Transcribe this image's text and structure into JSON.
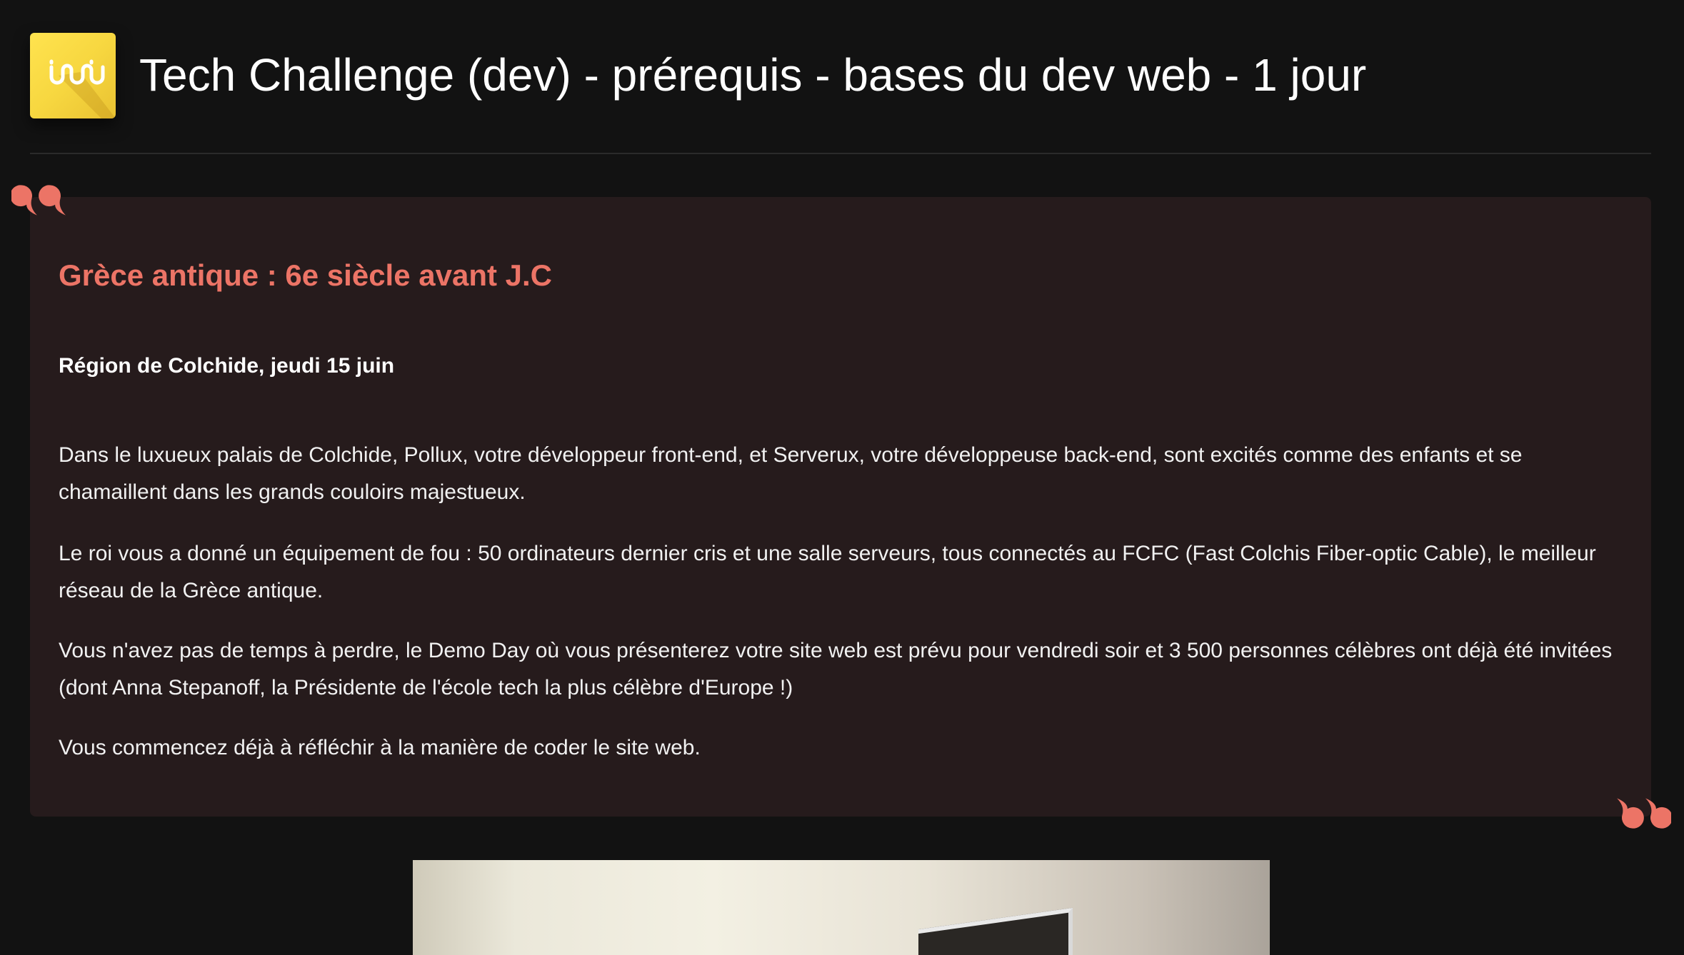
{
  "header": {
    "logo_icon": "wave-logo-icon",
    "title": "Tech Challenge (dev) - prérequis - bases du dev web - 1 jour"
  },
  "story": {
    "title": "Grèce antique : 6e siècle avant J.C",
    "subtitle": "Région de Colchide, jeudi 15 juin",
    "paragraphs": [
      "Dans le luxueux palais de Colchide, Pollux, votre développeur front-end, et Serverux, votre développeuse back-end, sont excités comme des enfants et se chamaillent dans les grands couloirs majestueux.",
      "Le roi vous a donné un équipement de fou : 50 ordinateurs dernier cris et une salle serveurs, tous connectés au FCFC (Fast Colchis Fiber-optic Cable), le meilleur réseau de la Grèce antique.",
      "Vous n'avez pas de temps à perdre, le Demo Day où vous présenterez votre site web est prévu pour vendredi soir et 3 500 personnes célèbres ont déjà été invitées (dont Anna Stepanoff, la Présidente de l'école tech la plus célèbre d'Europe !)",
      "Vous commencez déjà à réfléchir à la manière de coder le site web."
    ]
  },
  "colors": {
    "background": "#121212",
    "card": "#261b1c",
    "accent": "#ec7466",
    "logo": "#f7d740"
  }
}
